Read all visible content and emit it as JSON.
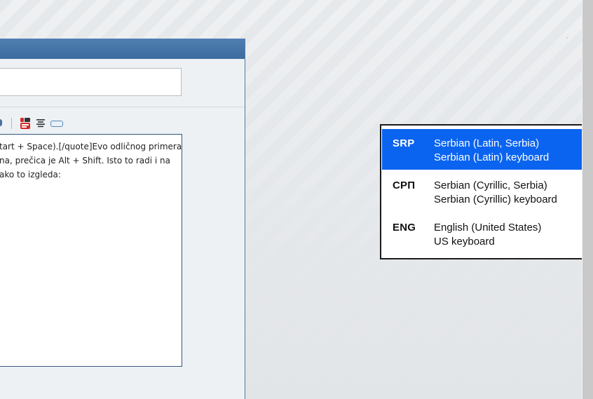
{
  "editor": {
    "text_lines": [
      "tart + Space).[/quote]Evo odličnog primera.",
      "na, prečica je Alt + Shift. Isto to radi i na",
      "ako to izgleda:"
    ],
    "toolbar": {
      "youtube_icon": "youtube-icon",
      "align_icon": "align-center-icon",
      "button_icon": "button-icon"
    }
  },
  "language_switcher": {
    "items": [
      {
        "code": "SRP",
        "name": "Serbian (Latin, Serbia)",
        "keyboard": "Serbian (Latin) keyboard",
        "selected": true
      },
      {
        "code": "СРП",
        "name": "Serbian (Cyrillic, Serbia)",
        "keyboard": "Serbian (Cyrillic) keyboard",
        "selected": false
      },
      {
        "code": "ENG",
        "name": "English (United States)",
        "keyboard": "US keyboard",
        "selected": false
      }
    ],
    "selected_color": "#0a64f0"
  },
  "colors": {
    "header_blue": "#3c6c9f",
    "popup_border": "#1a1a1a"
  }
}
